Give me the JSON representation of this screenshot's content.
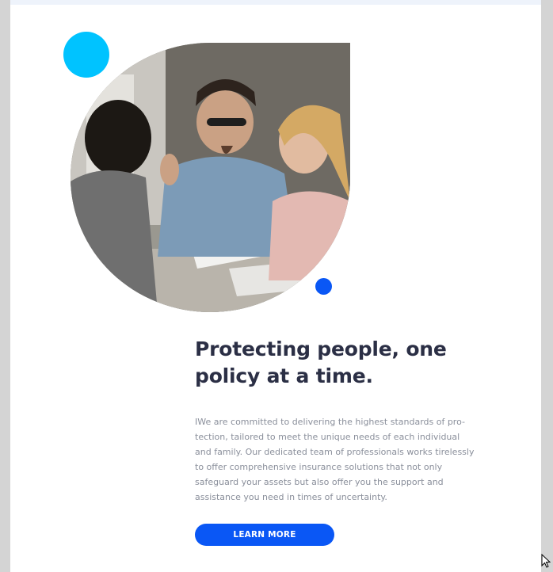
{
  "hero": {
    "heading": "Protecting people, one policy at a time.",
    "description": "IWe are committed to delivering the highest standards of pro-tection, tailored to meet the unique needs of each individual and family. Our dedicated team of professionals works tirelessly to offer comprehensive insurance solutions that not only safeguard your assets but also offer you the support and assistance you need in times of uncertainty.",
    "cta_label": "LEARN MORE"
  },
  "colors": {
    "accent_blue": "#0a57f5",
    "accent_cyan": "#00c3ff",
    "heading": "#2b2f45",
    "body": "#8a8f9b"
  },
  "icons": {
    "cursor": "mouse-pointer-icon"
  }
}
